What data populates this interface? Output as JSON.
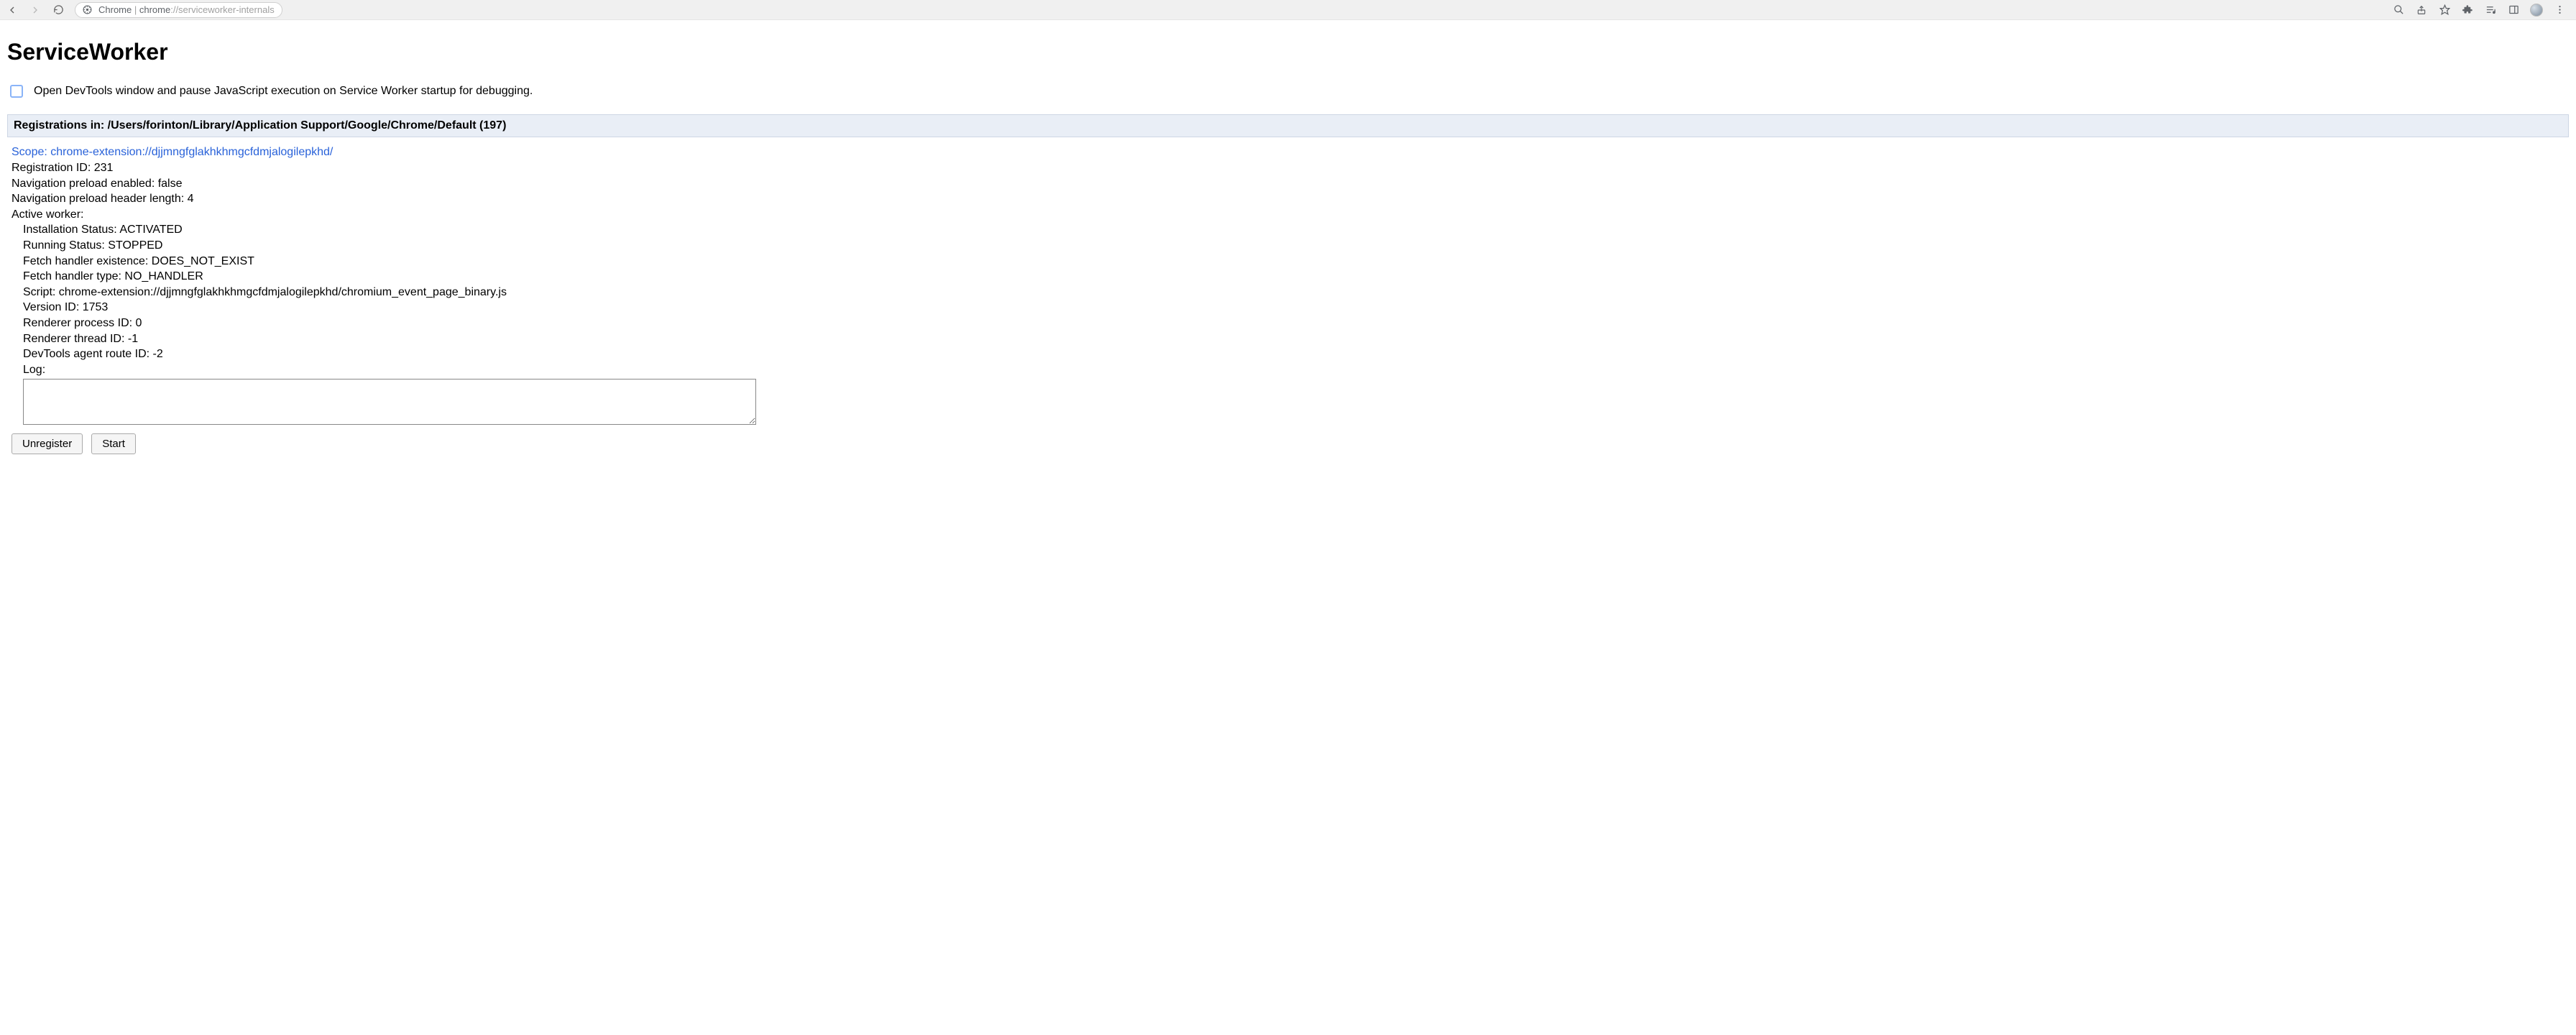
{
  "chrome": {
    "url_prefix": "Chrome",
    "url_separator": " | ",
    "url_scheme": "chrome",
    "url_rest": "://serviceworker-internals"
  },
  "page": {
    "title": "ServiceWorker",
    "debug_checkbox_label": "Open DevTools window and pause JavaScript execution on Service Worker startup for debugging.",
    "section_header": "Registrations in: /Users/forinton/Library/Application Support/Google/Chrome/Default (197)",
    "registration": {
      "scope_label": "Scope: ",
      "scope_value": "chrome-extension://djjmngfglakhkhmgcfdmjalogilepkhd/",
      "reg_id_label": "Registration ID: ",
      "reg_id_value": "231",
      "nav_preload_enabled_label": "Navigation preload enabled: ",
      "nav_preload_enabled_value": "false",
      "nav_preload_header_label": "Navigation preload header length: ",
      "nav_preload_header_value": "4",
      "active_worker_label": "Active worker:",
      "install_status_label": "Installation Status: ",
      "install_status_value": "ACTIVATED",
      "running_status_label": "Running Status: ",
      "running_status_value": "STOPPED",
      "fetch_existence_label": "Fetch handler existence: ",
      "fetch_existence_value": "DOES_NOT_EXIST",
      "fetch_type_label": "Fetch handler type: ",
      "fetch_type_value": "NO_HANDLER",
      "script_label": "Script: ",
      "script_value": "chrome-extension://djjmngfglakhkhmgcfdmjalogilepkhd/chromium_event_page_binary.js",
      "version_id_label": "Version ID: ",
      "version_id_value": "1753",
      "renderer_pid_label": "Renderer process ID: ",
      "renderer_pid_value": "0",
      "renderer_tid_label": "Renderer thread ID: ",
      "renderer_tid_value": "-1",
      "devtools_route_label": "DevTools agent route ID: ",
      "devtools_route_value": "-2",
      "log_label": "Log:",
      "log_value": ""
    },
    "buttons": {
      "unregister": "Unregister",
      "start": "Start"
    }
  }
}
